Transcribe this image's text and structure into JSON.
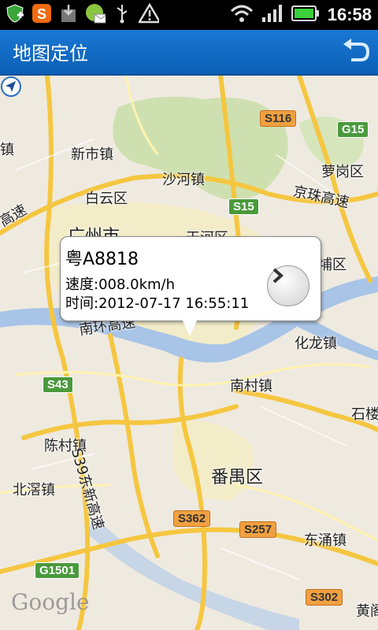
{
  "status": {
    "time": "16:58"
  },
  "header": {
    "title": "地图定位"
  },
  "info": {
    "plate": "粤A8818",
    "speed": "速度:008.0km/h",
    "time": "时间:2012-07-17 16:55:11"
  },
  "map": {
    "labels": {
      "xinshi": "新市镇",
      "shahe": "沙河镇",
      "luogang": "萝岗区",
      "baiyun": "白云区",
      "guangzhou": "广州市",
      "tianhe": "天河区",
      "huangpu": "埔区",
      "nanhuan": "南环高速",
      "jingzhu": "京珠高速",
      "gaosu_left": "高速",
      "zhen_left": "镇",
      "hualong": "化龙镇",
      "nancun": "南村镇",
      "shiqi": "石楼",
      "chencun": "陈村镇",
      "dongxin": "S39东新高速",
      "beijiao": "北滘镇",
      "panyu": "番禺区",
      "dongchong": "东涌镇",
      "huangge": "黄阁",
      "google": "Google"
    },
    "shields": {
      "s116": "S116",
      "g15": "G15",
      "s15": "S15",
      "s43": "S43",
      "s362": "S362",
      "s257": "S257",
      "g1501": "G1501",
      "s302": "S302"
    }
  }
}
